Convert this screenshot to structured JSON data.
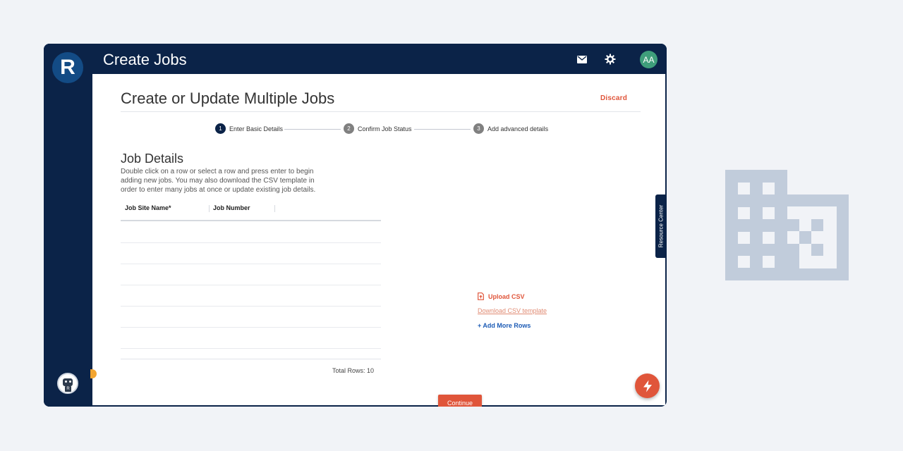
{
  "topbar": {
    "title": "Create Jobs",
    "avatar_initials": "AA",
    "mail_icon": "mail-icon",
    "settings_icon": "gear-icon"
  },
  "sidebar": {
    "logo_letter": "R",
    "assistant_badge": "R"
  },
  "page": {
    "title": "Create or Update Multiple Jobs",
    "discard_label": "Discard"
  },
  "stepper": {
    "steps": [
      {
        "number": "1",
        "label": "Enter Basic Details",
        "active": true
      },
      {
        "number": "2",
        "label": "Confirm Job Status",
        "active": false
      },
      {
        "number": "3",
        "label": "Add advanced details",
        "active": false
      }
    ]
  },
  "job_details": {
    "title": "Job Details",
    "description": "Double click on a row or select a row and press enter to begin adding new jobs. You may also download the CSV template in order to enter many jobs at once or update existing job details.",
    "columns": [
      "Job Site Name*",
      "Job Number"
    ],
    "total_rows_label": "Total Rows: 10"
  },
  "actions": {
    "upload_label": "Upload CSV",
    "download_label": "Download CSV template",
    "add_rows_label": "+ Add More Rows",
    "continue_label": "Continue"
  },
  "resource_center_label": "Resource Center",
  "colors": {
    "navy": "#0b2348",
    "accent": "#e0553a",
    "link_blue": "#1c5bb5",
    "avatar_green": "#3f9e7b",
    "building_gray": "#c1ccdb"
  }
}
